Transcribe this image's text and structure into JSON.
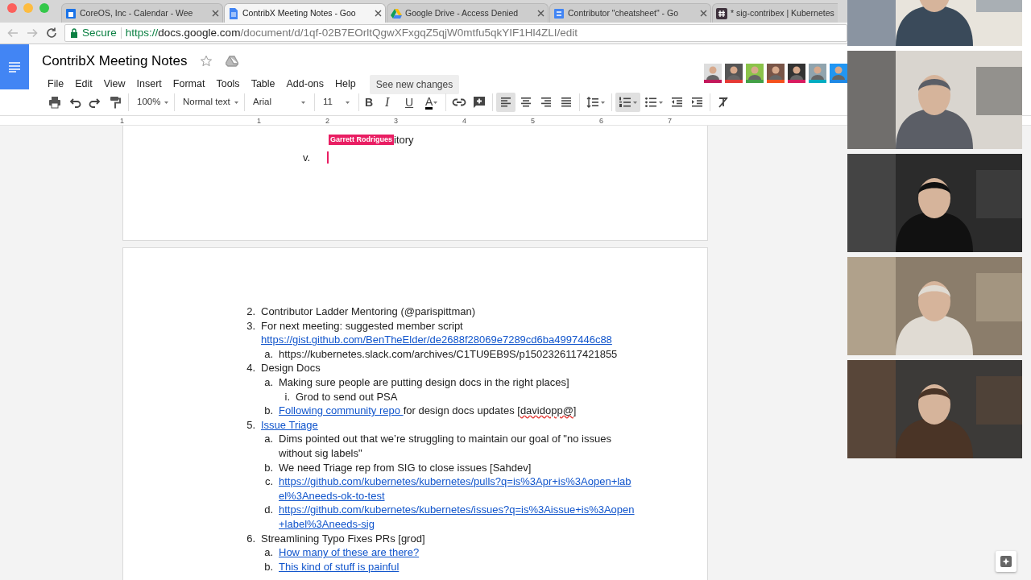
{
  "browser": {
    "tabs": [
      {
        "title": "CoreOS, Inc - Calendar - Wee",
        "kind": "calendar",
        "selected": false
      },
      {
        "title": "ContribX Meeting Notes - Goo",
        "kind": "docs",
        "selected": true
      },
      {
        "title": "Google Drive - Access Denied",
        "kind": "drive",
        "selected": false
      },
      {
        "title": "Contributor \"cheatsheet\" - Go",
        "kind": "form",
        "selected": false
      },
      {
        "title": "* sig-contribex | Kubernetes",
        "kind": "slack",
        "selected": false
      }
    ],
    "address": {
      "secure": "Secure",
      "scheme": "https://",
      "host": "docs.google.com",
      "path": "/document/d/1qf-02B7EOrltQgwXFxgqZ5qjW0mtfu5qkYIF1Hl4ZLI/edit"
    }
  },
  "document": {
    "title": "ContribX Meeting Notes",
    "menus": [
      "File",
      "Edit",
      "View",
      "Insert",
      "Format",
      "Tools",
      "Table",
      "Add-ons",
      "Help"
    ],
    "changes_button": "See new changes",
    "collaborators": [
      {
        "color": "#c2185b"
      },
      {
        "color": "#e53935"
      },
      {
        "color": "#43a047"
      },
      {
        "color": "#f4511e"
      },
      {
        "color": "#d81b60"
      },
      {
        "color": "#00acc1"
      },
      {
        "color": "#1e88e5"
      }
    ],
    "toolbar": [
      [
        {
          "kind": "print"
        },
        {
          "kind": "undo"
        },
        {
          "kind": "redo"
        },
        {
          "kind": "paint-format"
        }
      ],
      [
        {
          "kind": "dropdown",
          "label": "100%"
        }
      ],
      [
        {
          "kind": "dropdown",
          "label": "Normal text"
        }
      ],
      [
        {
          "kind": "dropdown",
          "label": "Arial"
        }
      ],
      [
        {
          "kind": "dropdown",
          "label": "11"
        }
      ],
      [
        {
          "kind": "bold",
          "label": "B",
          "selected": false
        },
        {
          "kind": "italic",
          "label": "I",
          "selected": false
        },
        {
          "kind": "underline",
          "label": "U",
          "selected": false
        },
        {
          "kind": "text-color",
          "label": "A"
        }
      ],
      [
        {
          "kind": "link"
        },
        {
          "kind": "comment"
        }
      ],
      [
        {
          "kind": "align-left",
          "selected": true
        },
        {
          "kind": "align-center",
          "selected": false
        },
        {
          "kind": "align-right",
          "selected": false
        },
        {
          "kind": "justify",
          "selected": false
        }
      ],
      [
        {
          "kind": "line-spacing"
        }
      ],
      [
        {
          "kind": "numbered-list",
          "selected": true
        },
        {
          "kind": "bulleted-list",
          "selected": false
        },
        {
          "kind": "decrease-indent"
        },
        {
          "kind": "increase-indent"
        }
      ],
      [
        {
          "kind": "clear-formatting"
        }
      ]
    ],
    "ruler": [
      "1",
      "1",
      "2",
      "3",
      "4",
      "5",
      "6",
      "7"
    ],
    "page_tail": {
      "text": "itory",
      "marker": "v.",
      "cursor": {
        "name": "Garrett Rodrigues",
        "color": "#e91e63"
      }
    },
    "items": [
      {
        "marker": "2.",
        "segments": [
          {
            "text": "Contributor Ladder Mentoring (@parispittman)"
          }
        ]
      },
      {
        "marker": "3.",
        "segments": [
          {
            "text": "For next meeting: suggested member script "
          },
          {
            "text": "https://gist.github.com/BenTheElder/de2688f28069e7289cd6ba4997446c88",
            "link": true
          }
        ],
        "children": [
          {
            "marker": "a.",
            "segments": [
              {
                "text": "https://kubernetes.slack.com/archives/C1TU9EB9S/p1502326117421855"
              }
            ]
          }
        ]
      },
      {
        "marker": "4.",
        "segments": [
          {
            "text": "Design Docs"
          }
        ],
        "children": [
          {
            "marker": "a.",
            "segments": [
              {
                "text": "Making sure people are putting design docs in the right places]"
              }
            ],
            "children": [
              {
                "marker": "i.",
                "segments": [
                  {
                    "text": "Grod to send out PSA"
                  }
                ]
              }
            ]
          },
          {
            "marker": "b.",
            "segments": [
              {
                "text": "Following community repo ",
                "link": true
              },
              {
                "text": "for design docs updates ["
              },
              {
                "text": "davidopp@",
                "misspelled": true
              },
              {
                "text": "]"
              }
            ]
          }
        ]
      },
      {
        "marker": "5.",
        "segments": [
          {
            "text": "Issue Triage",
            "link": true
          }
        ],
        "children": [
          {
            "marker": "a.",
            "segments": [
              {
                "text": "Dims pointed out that we’re struggling to maintain our goal of \"no issues without sig labels\""
              }
            ]
          },
          {
            "marker": "b.",
            "segments": [
              {
                "text": "We need Triage rep from SIG to close issues [Sahdev]"
              }
            ]
          },
          {
            "marker": "c.",
            "segments": [
              {
                "text": "https://github.com/kubernetes/kubernetes/pulls?q=is%3Apr+is%3Aopen+label%3Aneeds-ok-to-test",
                "link": true
              }
            ]
          },
          {
            "marker": "d.",
            "segments": [
              {
                "text": "https://github.com/kubernetes/kubernetes/issues?q=is%3Aissue+is%3Aopen+label%3Aneeds-sig",
                "link": true
              }
            ]
          }
        ]
      },
      {
        "marker": "6.",
        "segments": [
          {
            "text": "Streamlining Typo Fixes PRs [grod]"
          }
        ],
        "children": [
          {
            "marker": "a.",
            "segments": [
              {
                "text": "How many of these are there?",
                "link": true
              }
            ]
          },
          {
            "marker": "b.",
            "segments": [
              {
                "text": "This kind of stuff is painful",
                "link": true
              }
            ]
          }
        ]
      }
    ]
  }
}
